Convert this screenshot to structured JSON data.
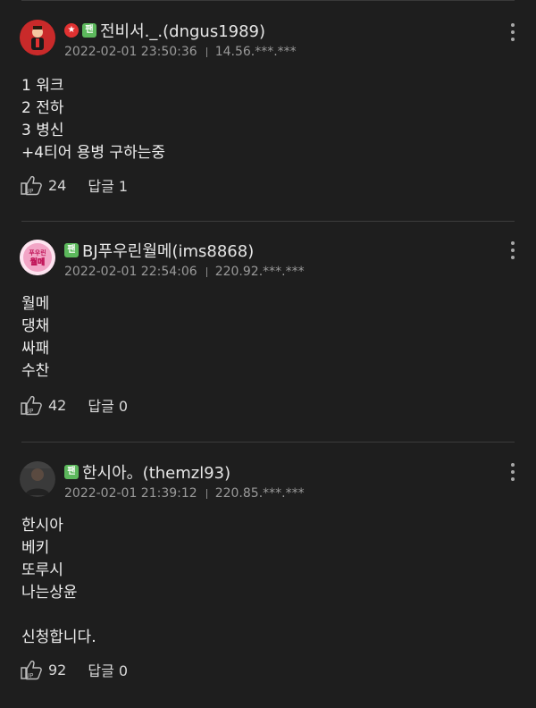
{
  "comments": [
    {
      "badges": [
        "star",
        "fan"
      ],
      "fan_label": "팬",
      "nickname": "전비서._.(dngus1989)",
      "timestamp": "2022-02-01 23:50:36",
      "ip": "14.56.***.***",
      "lines": [
        "1 워크",
        "2 전하",
        "3 병신",
        "+4티어 용병 구하는중"
      ],
      "likes": "24",
      "reply_label": "답글",
      "reply_count": "1",
      "avatar_icon": "red-character-avatar"
    },
    {
      "badges": [
        "fan"
      ],
      "fan_label": "팬",
      "nickname": "BJ푸우린월메(ims8868)",
      "timestamp": "2022-02-01 22:54:06",
      "ip": "220.92.***.***",
      "lines": [
        "월메",
        "댕채",
        "싸패",
        "수찬"
      ],
      "likes": "42",
      "reply_label": "답글",
      "reply_count": "0",
      "avatar_icon": "pink-logo-avatar",
      "avatar_text": "푸우린\n월메"
    },
    {
      "badges": [
        "fan"
      ],
      "fan_label": "팬",
      "nickname": "한시아。(themzl93)",
      "timestamp": "2022-02-01 21:39:12",
      "ip": "220.85.***.***",
      "lines": [
        "한시아",
        "베키",
        "또루시",
        "나는상윤",
        "",
        "신청합니다."
      ],
      "likes": "92",
      "reply_label": "답글",
      "reply_count": "0",
      "avatar_icon": "photo-avatar"
    }
  ],
  "colors": {
    "background": "#1e1e1e",
    "fan_badge": "#5cb85c",
    "star_badge": "#e03131",
    "meta_text": "#9a9a9a"
  }
}
